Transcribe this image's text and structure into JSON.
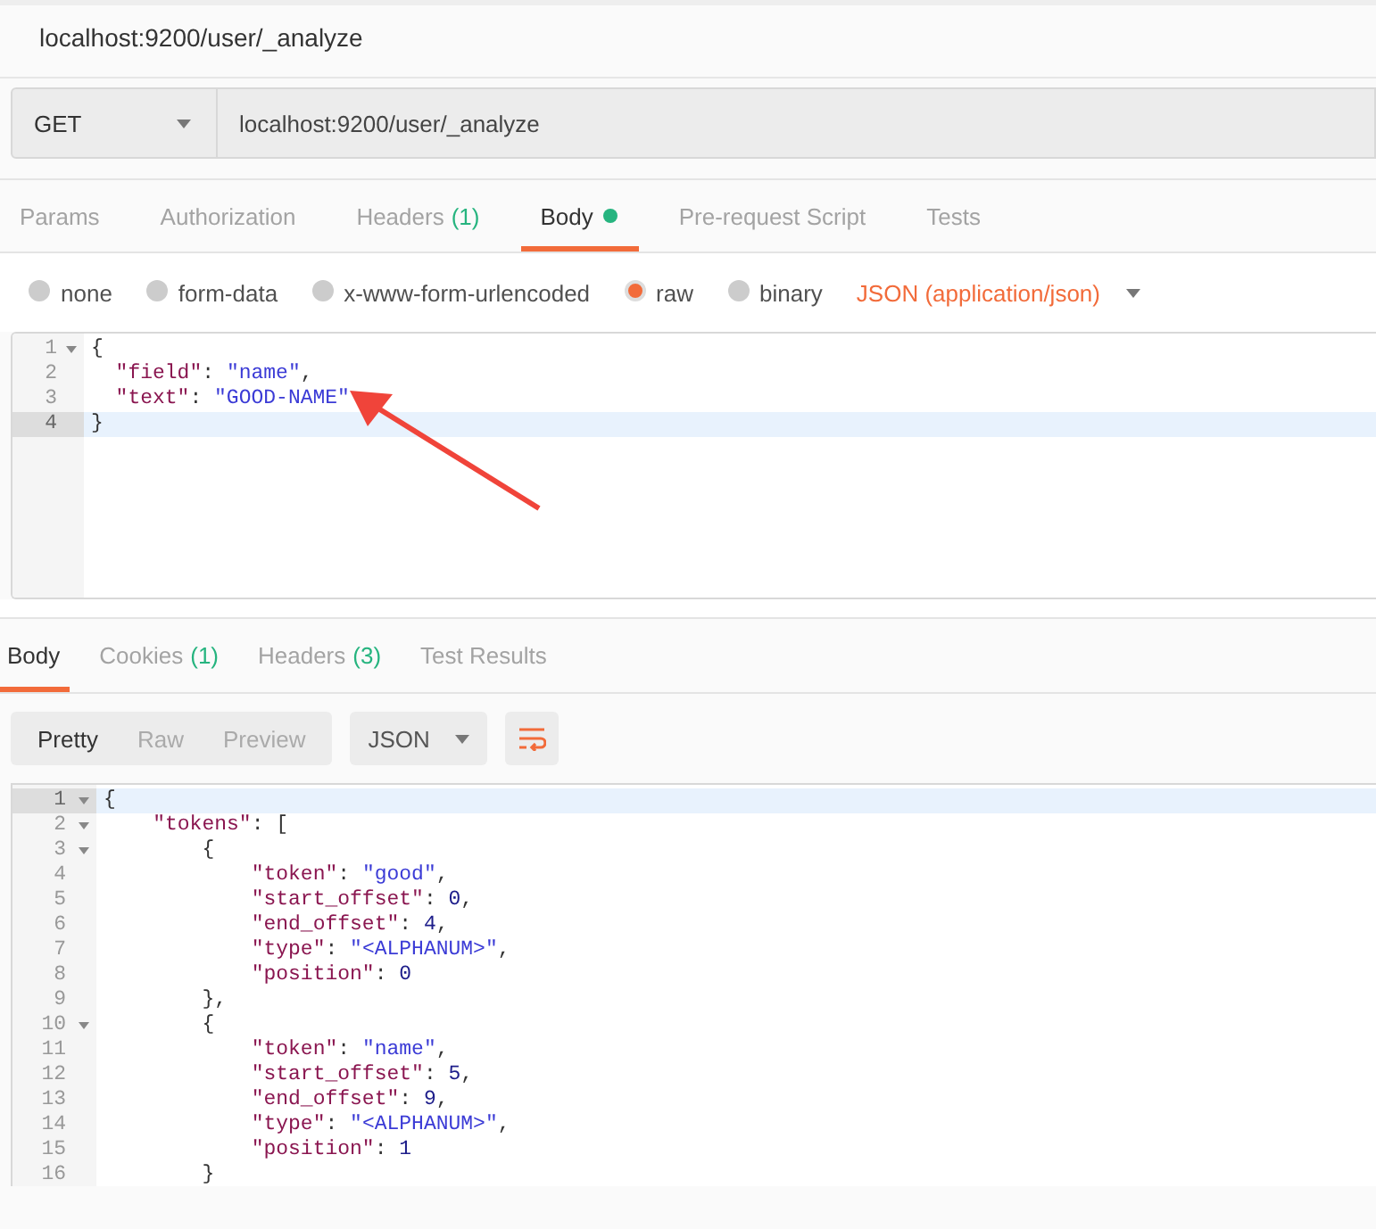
{
  "title": "localhost:9200/user/_analyze",
  "request": {
    "method": "GET",
    "url": "localhost:9200/user/_analyze"
  },
  "request_tabs": [
    {
      "label": "Params",
      "dot": false,
      "selected": false
    },
    {
      "label": "Authorization",
      "dot": false,
      "selected": false
    },
    {
      "label": "Headers",
      "count": "(1)",
      "dot": false,
      "selected": false
    },
    {
      "label": "Body",
      "dot": true,
      "selected": true
    },
    {
      "label": "Pre-request Script",
      "dot": false,
      "selected": false
    },
    {
      "label": "Tests",
      "dot": false,
      "selected": false
    }
  ],
  "body_types": [
    {
      "label": "none",
      "selected": false
    },
    {
      "label": "form-data",
      "selected": false
    },
    {
      "label": "x-www-form-urlencoded",
      "selected": false
    },
    {
      "label": "raw",
      "selected": true
    },
    {
      "label": "binary",
      "selected": false
    }
  ],
  "content_type": "JSON (application/json)",
  "request_body": [
    {
      "number": "1",
      "fold": true,
      "selected": false,
      "tokens": [
        {
          "kind": "punct",
          "text": "{"
        }
      ]
    },
    {
      "number": "2",
      "fold": false,
      "selected": false,
      "tokens": [
        {
          "kind": "key",
          "text": "  \"field\""
        },
        {
          "kind": "punct",
          "text": ": "
        },
        {
          "kind": "string",
          "text": "\"name\""
        },
        {
          "kind": "punct",
          "text": ","
        }
      ]
    },
    {
      "number": "3",
      "fold": false,
      "selected": false,
      "tokens": [
        {
          "kind": "key",
          "text": "  \"text\""
        },
        {
          "kind": "punct",
          "text": ": "
        },
        {
          "kind": "string",
          "text": "\"GOOD-NAME\""
        }
      ]
    },
    {
      "number": "4",
      "fold": false,
      "selected": true,
      "tokens": [
        {
          "kind": "punct",
          "text": "}"
        }
      ]
    }
  ],
  "response_tabs": [
    {
      "label": "Body",
      "dot": false,
      "selected": true
    },
    {
      "label": "Cookies",
      "count": "(1)",
      "dot": false,
      "selected": false
    },
    {
      "label": "Headers",
      "count": "(3)",
      "dot": false,
      "selected": false
    },
    {
      "label": "Test Results",
      "dot": false,
      "selected": false
    }
  ],
  "view_modes": [
    {
      "label": "Pretty",
      "selected": true
    },
    {
      "label": "Raw",
      "selected": false
    },
    {
      "label": "Preview",
      "selected": false
    }
  ],
  "response_format": "JSON",
  "response_body": [
    {
      "number": "1",
      "fold": true,
      "selected": true,
      "tokens": [
        {
          "kind": "punct",
          "text": "{"
        }
      ]
    },
    {
      "number": "2",
      "fold": true,
      "selected": false,
      "tokens": [
        {
          "kind": "key",
          "text": "    \"tokens\""
        },
        {
          "kind": "punct",
          "text": ": ["
        }
      ]
    },
    {
      "number": "3",
      "fold": true,
      "selected": false,
      "tokens": [
        {
          "kind": "punct",
          "text": "        {"
        }
      ]
    },
    {
      "number": "4",
      "fold": false,
      "selected": false,
      "tokens": [
        {
          "kind": "key",
          "text": "            \"token\""
        },
        {
          "kind": "punct",
          "text": ": "
        },
        {
          "kind": "string",
          "text": "\"good\""
        },
        {
          "kind": "punct",
          "text": ","
        }
      ]
    },
    {
      "number": "5",
      "fold": false,
      "selected": false,
      "tokens": [
        {
          "kind": "key",
          "text": "            \"start_offset\""
        },
        {
          "kind": "punct",
          "text": ": "
        },
        {
          "kind": "number",
          "text": "0"
        },
        {
          "kind": "punct",
          "text": ","
        }
      ]
    },
    {
      "number": "6",
      "fold": false,
      "selected": false,
      "tokens": [
        {
          "kind": "key",
          "text": "            \"end_offset\""
        },
        {
          "kind": "punct",
          "text": ": "
        },
        {
          "kind": "number",
          "text": "4"
        },
        {
          "kind": "punct",
          "text": ","
        }
      ]
    },
    {
      "number": "7",
      "fold": false,
      "selected": false,
      "tokens": [
        {
          "kind": "key",
          "text": "            \"type\""
        },
        {
          "kind": "punct",
          "text": ": "
        },
        {
          "kind": "string",
          "text": "\"<ALPHANUM>\""
        },
        {
          "kind": "punct",
          "text": ","
        }
      ]
    },
    {
      "number": "8",
      "fold": false,
      "selected": false,
      "tokens": [
        {
          "kind": "key",
          "text": "            \"position\""
        },
        {
          "kind": "punct",
          "text": ": "
        },
        {
          "kind": "number",
          "text": "0"
        }
      ]
    },
    {
      "number": "9",
      "fold": false,
      "selected": false,
      "tokens": [
        {
          "kind": "punct",
          "text": "        },"
        }
      ]
    },
    {
      "number": "10",
      "fold": true,
      "selected": false,
      "tokens": [
        {
          "kind": "punct",
          "text": "        {"
        }
      ]
    },
    {
      "number": "11",
      "fold": false,
      "selected": false,
      "tokens": [
        {
          "kind": "key",
          "text": "            \"token\""
        },
        {
          "kind": "punct",
          "text": ": "
        },
        {
          "kind": "string",
          "text": "\"name\""
        },
        {
          "kind": "punct",
          "text": ","
        }
      ]
    },
    {
      "number": "12",
      "fold": false,
      "selected": false,
      "tokens": [
        {
          "kind": "key",
          "text": "            \"start_offset\""
        },
        {
          "kind": "punct",
          "text": ": "
        },
        {
          "kind": "number",
          "text": "5"
        },
        {
          "kind": "punct",
          "text": ","
        }
      ]
    },
    {
      "number": "13",
      "fold": false,
      "selected": false,
      "tokens": [
        {
          "kind": "key",
          "text": "            \"end_offset\""
        },
        {
          "kind": "punct",
          "text": ": "
        },
        {
          "kind": "number",
          "text": "9"
        },
        {
          "kind": "punct",
          "text": ","
        }
      ]
    },
    {
      "number": "14",
      "fold": false,
      "selected": false,
      "tokens": [
        {
          "kind": "key",
          "text": "            \"type\""
        },
        {
          "kind": "punct",
          "text": ": "
        },
        {
          "kind": "string",
          "text": "\"<ALPHANUM>\""
        },
        {
          "kind": "punct",
          "text": ","
        }
      ]
    },
    {
      "number": "15",
      "fold": false,
      "selected": false,
      "tokens": [
        {
          "kind": "key",
          "text": "            \"position\""
        },
        {
          "kind": "punct",
          "text": ": "
        },
        {
          "kind": "number",
          "text": "1"
        }
      ]
    },
    {
      "number": "16",
      "fold": false,
      "selected": false,
      "tokens": [
        {
          "kind": "punct",
          "text": "        }"
        }
      ]
    }
  ]
}
